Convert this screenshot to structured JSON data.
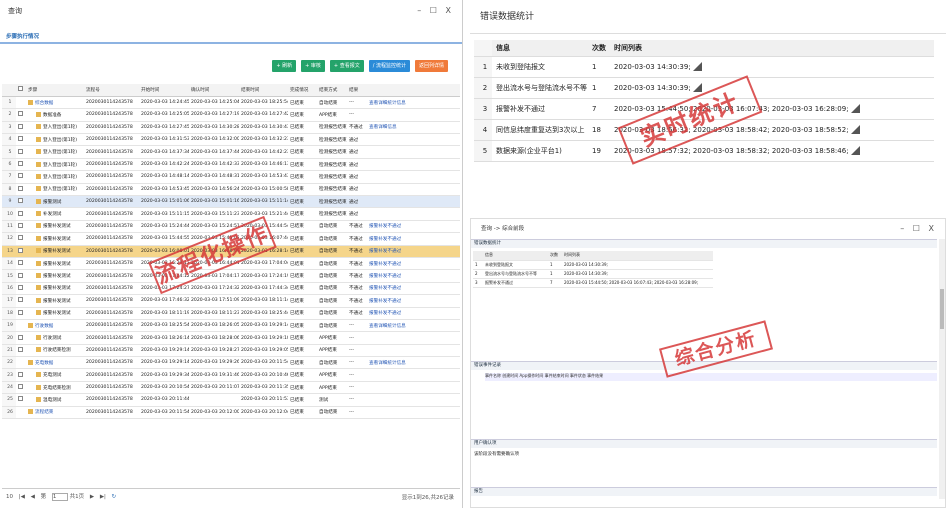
{
  "left": {
    "title": "查询",
    "controls": "– ☐ X",
    "subheader": "步骤执行情况",
    "buttons": [
      "+ 刷新",
      "+ 审核",
      "+ 查看报文",
      "/ 流程监控统计",
      "返回列详情"
    ],
    "columns": [
      "步骤",
      "流程号",
      "开始时间",
      "确认时间",
      "结束时间",
      "完成情况",
      "结束方式",
      "结果"
    ],
    "rows": [
      [
        "1",
        "综合数据",
        "2020030114243578",
        "2020-03-03 14:24:45",
        "2020-03-03 14:25:04",
        "2020-03-03 18:25:54",
        "已结束",
        "自动结束",
        "---",
        "查看详细统计信息"
      ],
      [
        "2",
        "数据准备",
        "2020030114243578",
        "2020-03-03 14:25:05",
        "2020-03-03 14:27:19",
        "2020-03-03 14:27:42",
        "已结束",
        "APP结束",
        "---",
        ""
      ],
      [
        "3",
        "登入登出(第1轮)",
        "2020030114243578",
        "2020-03-03 14:27:45",
        "2020-03-03 14:30:28",
        "2020-03-03 14:30:43",
        "已结束",
        "检测报告结束",
        "不通过",
        "查看详细信息"
      ],
      [
        "4",
        "登入登出(第1轮)",
        "2020030114243578",
        "2020-03-03 14:31:53",
        "2020-03-03 14:32:00",
        "2020-03-03 14:32:23",
        "已结束",
        "检测报告结束",
        "通过",
        ""
      ],
      [
        "5",
        "登入登出(第1轮)",
        "2020030114243578",
        "2020-03-03 14:37:34",
        "2020-03-03 14:37:44",
        "2020-03-03 14:42:23",
        "已结束",
        "检测报告结束",
        "通过",
        ""
      ],
      [
        "6",
        "登入登出(第1轮)",
        "2020030114243578",
        "2020-03-03 14:42:24",
        "2020-03-03 14:42:33",
        "2020-03-03 14:46:13",
        "已结束",
        "检测报告结束",
        "通过",
        ""
      ],
      [
        "7",
        "登入登出(第1轮)",
        "2020030114243578",
        "2020-03-03 14:48:14",
        "2020-03-03 14:48:31",
        "2020-03-03 14:53:43",
        "已结束",
        "检测报告结束",
        "通过",
        ""
      ],
      [
        "8",
        "登入登出(第1轮)",
        "2020030114243578",
        "2020-03-03 14:53:45",
        "2020-03-03 14:56:24",
        "2020-03-03 15:00:58",
        "已结束",
        "检测报告结束",
        "通过",
        ""
      ],
      [
        "9",
        "报警测试",
        "2020030114243578",
        "2020-03-03 15:01:06",
        "2020-03-03 15:01:16",
        "2020-03-03 15:11:14",
        "已结束",
        "检测报告结束",
        "通过",
        ""
      ],
      [
        "10",
        "补发测试",
        "2020030114243578",
        "2020-03-03 15:11:15",
        "2020-03-03 15:11:23",
        "2020-03-03 15:21:44",
        "已结束",
        "检测报告结束",
        "通过",
        ""
      ],
      [
        "11",
        "报警补发测试",
        "2020030114243578",
        "2020-03-03 15:24:44",
        "2020-03-03 15:24:51",
        "2020-03-03 15:44:54",
        "已结束",
        "自动结束",
        "不通过",
        "报警补发不通过"
      ],
      [
        "12",
        "报警补发测试",
        "2020030114243578",
        "2020-03-03 15:44:55",
        "2020-03-03 15:45:03",
        "2020-03-03 16:07:44",
        "已结束",
        "自动结束",
        "不通过",
        "报警补发不通过"
      ],
      [
        "13",
        "报警补发测试",
        "2020030114243578",
        "2020-03-03 16:08:01",
        "2020-03-03 16:08:09",
        "2020-03-03 16:28:14",
        "已结束",
        "自动结束",
        "不通过",
        "报警补发不通过"
      ],
      [
        "14",
        "报警补发测试",
        "2020030114243578",
        "2020-03-03 16:29:13",
        "2020-03-03 16:44:01",
        "2020-03-03 17:04:04",
        "已结束",
        "自动结束",
        "不通过",
        "报警补发不通过"
      ],
      [
        "15",
        "报警补发测试",
        "2020030114243578",
        "2020-03-03 17:04:12",
        "2020-03-03 17:04:17",
        "2020-03-03 17:24:19",
        "已结束",
        "自动结束",
        "不通过",
        "报警补发不通过"
      ],
      [
        "16",
        "报警补发测试",
        "2020030114243578",
        "2020-03-03 17:24:27",
        "2020-03-03 17:24:32",
        "2020-03-03 17:44:34",
        "已结束",
        "自动结束",
        "不通过",
        "报警补发不通过"
      ],
      [
        "17",
        "报警补发测试",
        "2020030114243578",
        "2020-03-03 17:46:32",
        "2020-03-03 17:51:09",
        "2020-03-03 18:11:14",
        "已结束",
        "自动结束",
        "不通过",
        "报警补发不通过"
      ],
      [
        "18",
        "报警补发测试",
        "2020030114243578",
        "2020-03-03 18:11:19",
        "2020-03-03 18:11:23",
        "2020-03-03 18:25:44",
        "已结束",
        "自动结束",
        "不通过",
        "报警补发不通过"
      ],
      [
        "19",
        "行驶数据",
        "2020030114243578",
        "2020-03-03 18:25:54",
        "2020-03-03 18:26:05",
        "2020-03-03 19:29:14",
        "已结束",
        "自动结束",
        "---",
        "查看详细统计信息"
      ],
      [
        "20",
        "行驶测试",
        "2020030114243578",
        "2020-03-03 18:26:14",
        "2020-03-03 18:28:06",
        "2020-03-03 19:29:10",
        "已结束",
        "APP结束",
        "---",
        ""
      ],
      [
        "21",
        "行驶结束检测",
        "2020030114243578",
        "2020-03-03 19:29:14",
        "2020-03-03 19:28:27",
        "2020-03-03 19:29:05",
        "已结束",
        "APP结束",
        "---",
        ""
      ],
      [
        "22",
        "充电数据",
        "2020030114243578",
        "2020-03-03 19:29:14",
        "2020-03-03 19:29:26",
        "2020-03-03 20:11:54",
        "已结束",
        "自动结束",
        "---",
        "查看详细统计信息"
      ],
      [
        "23",
        "充电测试",
        "2020030114243578",
        "2020-03-03 19:29:34",
        "2020-03-03 19:31:46",
        "2020-03-03 20:10:46",
        "已结束",
        "APP结束",
        "---",
        ""
      ],
      [
        "24",
        "充电结束检测",
        "2020030114243578",
        "2020-03-03 20:10:54",
        "2020-03-03 20:11:07",
        "2020-03-03 20:11:35",
        "已结束",
        "APP结束",
        "---",
        ""
      ],
      [
        "25",
        "温电测试",
        "2020030114243578",
        "2020-03-03 20:11:44",
        "",
        "2020-03-03 20:11:53",
        "已结束",
        "测试",
        "---",
        ""
      ],
      [
        "26",
        "流程结束",
        "2020030114243578",
        "2020-03-03 20:11:54",
        "2020-03-03 20:12:00",
        "2020-03-03 20:12:04",
        "已结束",
        "自动结束",
        "---",
        ""
      ]
    ],
    "pager": {
      "size": "10",
      "page_label": "第",
      "page": "1",
      "of": "共1页",
      "summary": "显示1到26,共26记录"
    },
    "stamp": "流程化操作"
  },
  "right_top": {
    "title": "错误数据统计",
    "columns": [
      "信息",
      "次数",
      "时间列表"
    ],
    "rows": [
      [
        "1",
        "未收到登陆报文",
        "1",
        "2020-03-03 14:30:39;"
      ],
      [
        "2",
        "登出流水号与登陆流水号不等",
        "1",
        "2020-03-03 14:30:39;"
      ],
      [
        "3",
        "报警补发不通过",
        "7",
        "2020-03-03 15:44:50; 2020-03-03 16:07:43; 2020-03-03 16:28:09;"
      ],
      [
        "4",
        "同信息纬度重复达到3次以上",
        "18",
        "2020-03-03 18:56:32; 2020-03-03 18:58:42; 2020-03-03 18:58:52;"
      ],
      [
        "5",
        "数据来源(企业平台1)",
        "19",
        "2020-03-03 18:57:32; 2020-03-03 18:58:32; 2020-03-03 18:58:46;"
      ]
    ],
    "stamp": "实时统计"
  },
  "right_bottom": {
    "title": "查询 -> 综合前段",
    "controls": "– ☐ X",
    "sec1": "错误数据统计",
    "mini_cols": [
      "信息",
      "次数",
      "时间列表"
    ],
    "mini_rows": [
      [
        "1",
        "未收到登陆报文",
        "1",
        "2020-03-03 14:30:39;"
      ],
      [
        "2",
        "登出流水号与登陆流水号不等",
        "1",
        "2020-03-03 14:30:39;"
      ],
      [
        "3",
        "报警补发不通过",
        "7",
        "2020-03-03 15:44:50; 2020-03-03 16:07:43; 2020-03-03 16:28:09;"
      ]
    ],
    "sec2": "错误事件记录",
    "sec2_cols": "事件名称  创建时间  App操作时间  事件结束时间  事件状态  事件结果",
    "sec3": "用户确认项",
    "sec3_text": "该阶段没有需要确认项",
    "sec4": "报告",
    "stamp": "综合分析"
  }
}
